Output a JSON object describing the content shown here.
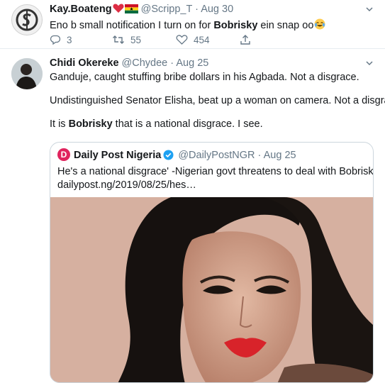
{
  "tweets": [
    {
      "name": "Kay.Boateng",
      "handle": "@Scripp_T",
      "separator": "·",
      "date": "Aug 30",
      "text_before": "Eno b small notification I turn on for ",
      "text_bold": "Bobrisky",
      "text_after": " ein snap oo",
      "replies": "3",
      "retweets": "55",
      "likes": "454"
    },
    {
      "name": "Chidi Okereke",
      "handle": "@Chydee",
      "separator": "·",
      "date": "Aug 25",
      "para1": "Ganduje, caught stuffing bribe dollars in his Agbada. Not a disgrace.",
      "para2": "Undistinguished Senator Elisha, beat up a woman on camera. Not a disgrace.",
      "para3_before": "It is ",
      "para3_bold": "Bobrisky",
      "para3_after": " that is a national disgrace. I see.",
      "quote": {
        "logo_letter": "D",
        "name": "Daily Post Nigeria",
        "handle": "@DailyPostNGR",
        "separator": "·",
        "date": "Aug 25",
        "line1": "He's a national disgrace' -Nigerian govt threatens to deal with Bobrisky",
        "line2": "dailypost.ng/2019/08/25/hes…"
      }
    }
  ],
  "icons": {
    "reply": "reply-icon",
    "retweet": "retweet-icon",
    "like": "heart-icon",
    "share": "share-icon",
    "caret": "chevron-down-icon",
    "verified": "verified-badge-icon"
  },
  "colors": {
    "text": "#14171a",
    "secondary": "#657786",
    "verified": "#1da1f2",
    "heart": "#e0245e",
    "logo": "#e0245e",
    "border": "#e6ecf0"
  }
}
